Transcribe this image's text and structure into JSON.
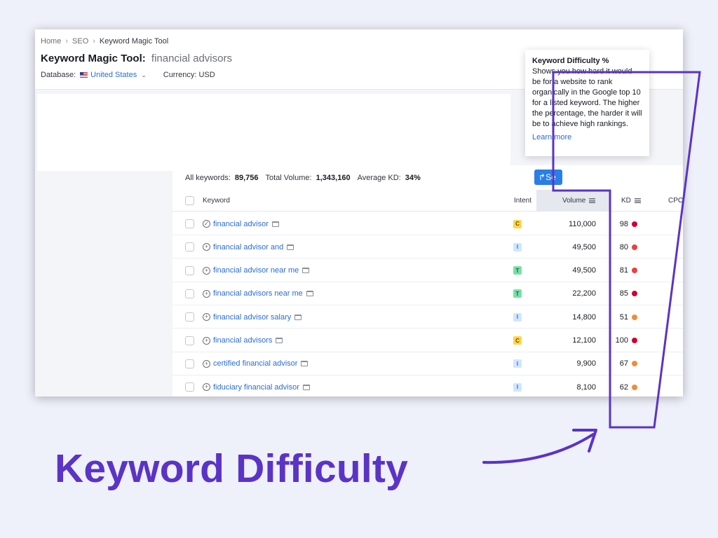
{
  "breadcrumb": {
    "home": "Home",
    "section": "SEO",
    "current": "Keyword Magic Tool",
    "separator": "›"
  },
  "header": {
    "title": "Keyword Magic Tool:",
    "query": "financial advisors"
  },
  "database": {
    "label": "Database:",
    "value": "United States",
    "currency_label": "Currency: USD"
  },
  "summary": {
    "all_keywords_label": "All keywords:",
    "all_keywords_value": "89,756",
    "total_volume_label": "Total Volume:",
    "total_volume_value": "1,343,160",
    "avg_kd_label": "Average KD:",
    "avg_kd_value": "34%"
  },
  "share_button": {
    "label": "Se"
  },
  "columns": {
    "keyword": "Keyword",
    "intent": "Intent",
    "volume": "Volume",
    "kd": "KD",
    "cpc": "CPC"
  },
  "rows": [
    {
      "keyword": "financial advisor",
      "icon": "check-circle-icon",
      "intent": "C",
      "volume": "110,000",
      "kd": "98",
      "kd_color": "#d1002f"
    },
    {
      "keyword": "financial advisor and",
      "icon": "plus-circle-icon",
      "intent": "I",
      "volume": "49,500",
      "kd": "80",
      "kd_color": "#f03e3e"
    },
    {
      "keyword": "financial advisor near me",
      "icon": "plus-circle-icon",
      "intent": "T",
      "volume": "49,500",
      "kd": "81",
      "kd_color": "#f03e3e"
    },
    {
      "keyword": "financial advisors near me",
      "icon": "plus-circle-icon",
      "intent": "T",
      "volume": "22,200",
      "kd": "85",
      "kd_color": "#d1002f"
    },
    {
      "keyword": "financial advisor salary",
      "icon": "plus-circle-icon",
      "intent": "I",
      "volume": "14,800",
      "kd": "51",
      "kd_color": "#f08c3a"
    },
    {
      "keyword": "financial advisors",
      "icon": "plus-circle-icon",
      "intent": "C",
      "volume": "12,100",
      "kd": "100",
      "kd_color": "#d1002f"
    },
    {
      "keyword": "certified financial advisor",
      "icon": "plus-circle-icon",
      "intent": "I",
      "volume": "9,900",
      "kd": "67",
      "kd_color": "#f08c3a"
    },
    {
      "keyword": "fiduciary financial advisor",
      "icon": "plus-circle-icon",
      "intent": "I",
      "volume": "8,100",
      "kd": "62",
      "kd_color": "#f08c3a"
    }
  ],
  "intent_colors": {
    "C": {
      "bg": "#ffd54a",
      "fg": "#6b5200"
    },
    "I": {
      "bg": "#cfe6ff",
      "fg": "#2a6cd8"
    },
    "T": {
      "bg": "#79e0a6",
      "fg": "#0b6b3a"
    }
  },
  "tooltip": {
    "title": "Keyword Difficulty %",
    "body": "Shows you how hard it would be for a website to rank organically in the Google top 10 for a listed keyword. The higher the percentage, the harder it will be to achieve high rankings.",
    "link": "Learn more"
  },
  "caption": "Keyword Difficulty",
  "colors": {
    "annotation": "#5b33c6",
    "link": "#2a6cd8"
  }
}
